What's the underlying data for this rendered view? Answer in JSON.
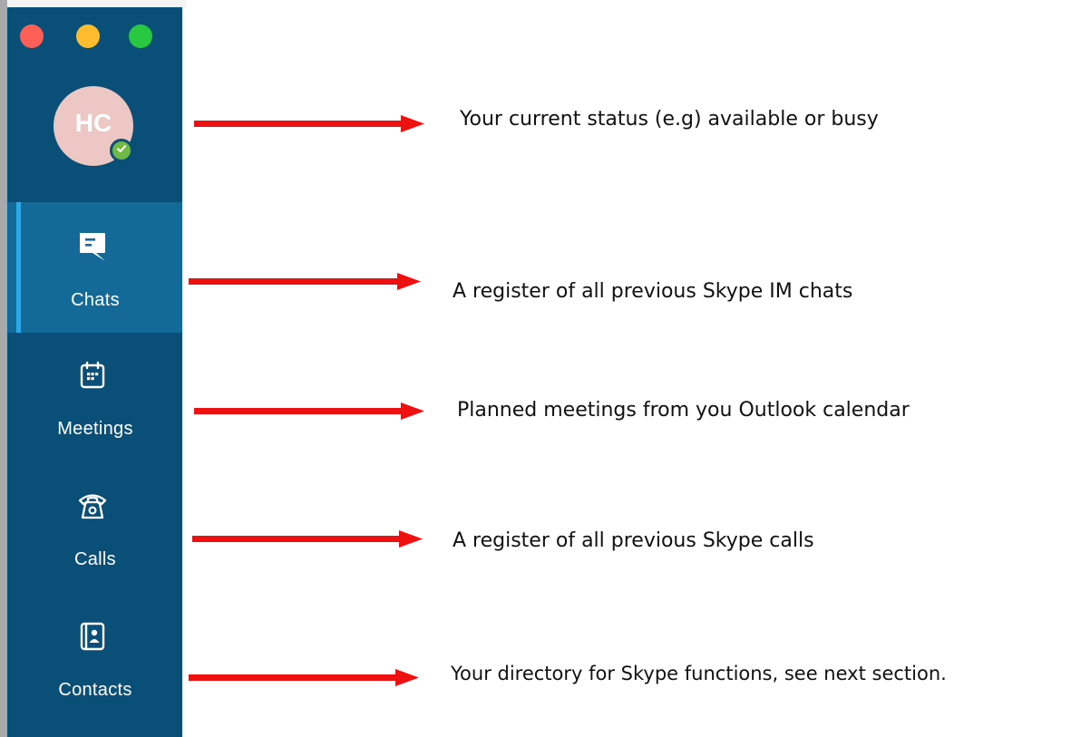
{
  "colors": {
    "sidebar": "#0a4f78",
    "selected_item": "#136a98",
    "selected_indicator": "#2aa8e8",
    "avatar_bg": "#edc7c3",
    "status_available": "#71b945",
    "traffic_close": "#ff5f57",
    "traffic_minimize": "#febc2e",
    "traffic_maximize": "#28c840",
    "arrow": "#ee1111"
  },
  "user": {
    "initials": "HC",
    "status_icon": "check-icon"
  },
  "nav": {
    "items": [
      {
        "label": "Chats",
        "icon": "chat-icon",
        "selected": true
      },
      {
        "label": "Meetings",
        "icon": "calendar-icon",
        "selected": false
      },
      {
        "label": "Calls",
        "icon": "phone-icon",
        "selected": false
      },
      {
        "label": "Contacts",
        "icon": "contacts-icon",
        "selected": false
      }
    ]
  },
  "annotations": [
    "Your current status (e.g) available or busy",
    "A register of all previous Skype IM chats",
    "Planned meetings from you Outlook calendar",
    "A register of all previous Skype calls",
    "Your directory for Skype functions, see next section."
  ]
}
